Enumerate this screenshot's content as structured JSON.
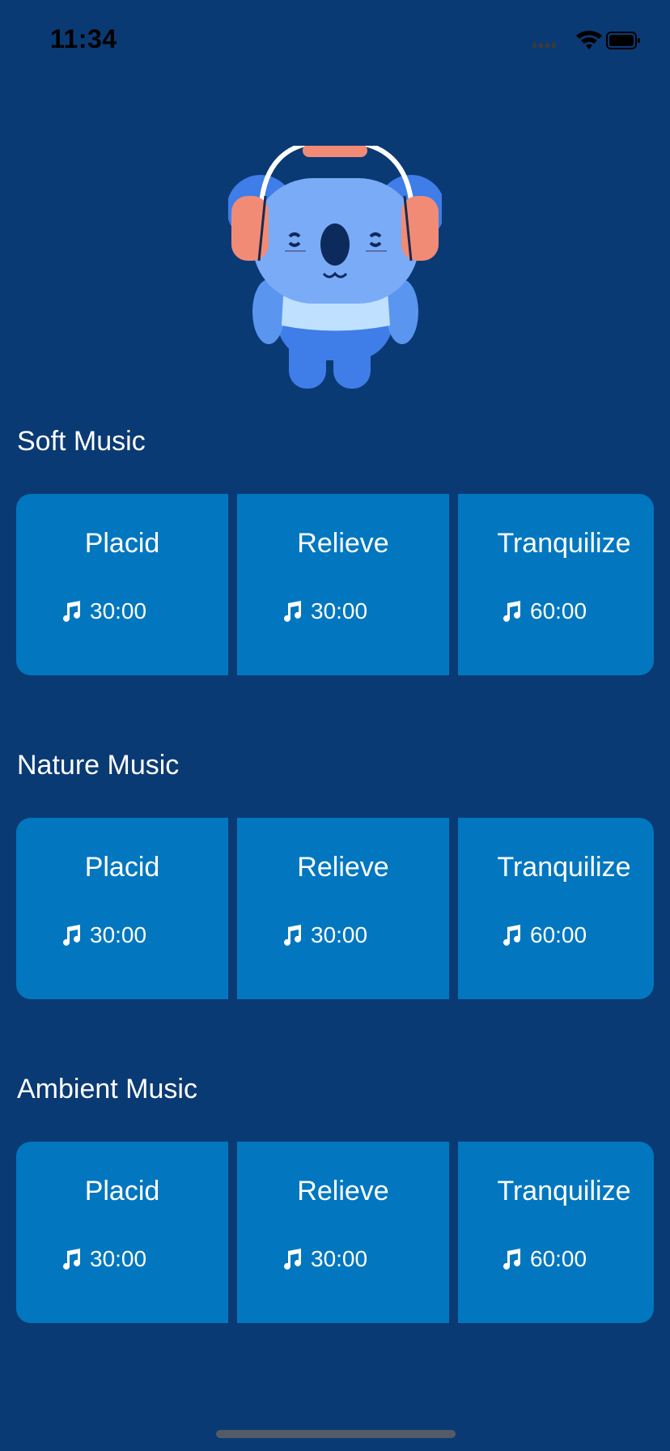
{
  "status_bar": {
    "time": "11:34"
  },
  "colors": {
    "background": "#0a3a74",
    "card": "#0277c0",
    "text": "#ffffff"
  },
  "mascot": {
    "icon": "koala-headphones-icon"
  },
  "sections": [
    {
      "title": "Soft Music",
      "cards": [
        {
          "title": "Placid",
          "duration": "30:00"
        },
        {
          "title": "Relieve",
          "duration": "30:00"
        },
        {
          "title": "Tranquilize",
          "duration": "60:00"
        }
      ]
    },
    {
      "title": "Nature Music",
      "cards": [
        {
          "title": "Placid",
          "duration": "30:00"
        },
        {
          "title": "Relieve",
          "duration": "30:00"
        },
        {
          "title": "Tranquilize",
          "duration": "60:00"
        }
      ]
    },
    {
      "title": "Ambient Music",
      "cards": [
        {
          "title": "Placid",
          "duration": "30:00"
        },
        {
          "title": "Relieve",
          "duration": "30:00"
        },
        {
          "title": "Tranquilize",
          "duration": "60:00"
        }
      ]
    }
  ]
}
